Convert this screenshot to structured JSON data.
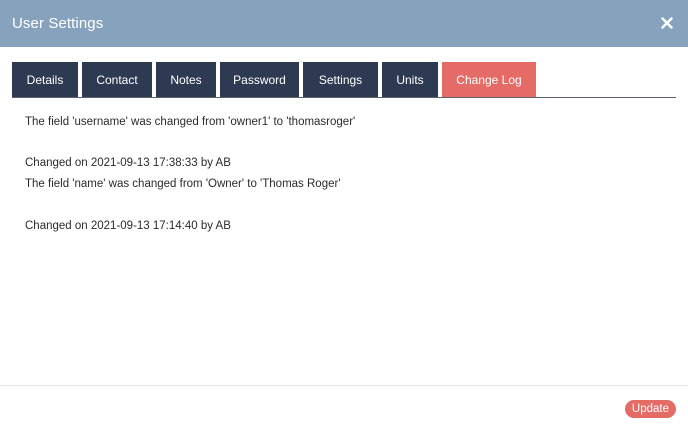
{
  "header": {
    "title": "User Settings",
    "close_icon": "close-icon"
  },
  "tabs": [
    {
      "label": "Details",
      "active": false
    },
    {
      "label": "Contact",
      "active": false
    },
    {
      "label": "Notes",
      "active": false
    },
    {
      "label": "Password",
      "active": false
    },
    {
      "label": "Settings",
      "active": false
    },
    {
      "label": "Units",
      "active": false
    },
    {
      "label": "Change Log",
      "active": true
    }
  ],
  "change_log": [
    {
      "text": "The field 'username' was changed from 'owner1' to 'thomasroger'",
      "changed": "Changed on 2021-09-13 17:38:33 by AB"
    },
    {
      "text": "The field 'name' was changed from 'Owner' to 'Thomas Roger'",
      "changed": "Changed on 2021-09-13 17:14:40 by AB"
    }
  ],
  "footer": {
    "update_label": "Update"
  },
  "colors": {
    "header_bg": "#87a2bd",
    "tab_bg": "#2e3a52",
    "accent": "#e46b66"
  }
}
